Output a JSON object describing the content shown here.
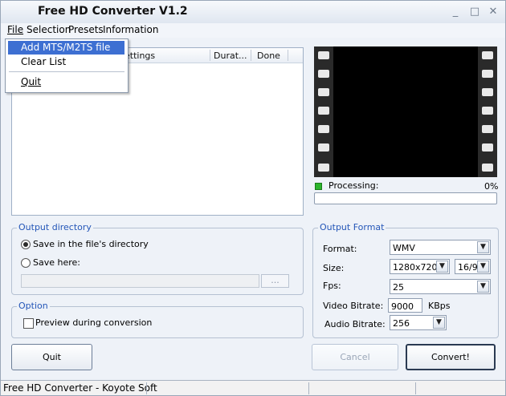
{
  "window": {
    "title": "Free HD Converter V1.2"
  },
  "titlebar_buttons": {
    "minimize": "_",
    "maximize": "□",
    "close": "✕"
  },
  "menu": [
    {
      "label": "File"
    },
    {
      "label": "Selection"
    },
    {
      "label": "Presets"
    },
    {
      "label": "Information"
    }
  ],
  "file_menu": {
    "items": [
      {
        "label": "Add MTS/M2TS file",
        "selected": true
      },
      {
        "label": "Clear List"
      },
      {
        "label": "Quit"
      }
    ]
  },
  "file_list": {
    "columns": [
      {
        "label": "ettings"
      },
      {
        "label": "Durat..."
      },
      {
        "label": "Done"
      }
    ],
    "rows": []
  },
  "preview": {
    "processing_label": "Processing:",
    "progress_text": "0%",
    "progress_value": 0
  },
  "output_directory": {
    "title": "Output directory",
    "option_same": "Save in the file's directory",
    "option_here": "Save here:",
    "selected": "same",
    "path_value": "",
    "browse_label": "..."
  },
  "option_group": {
    "title": "Option",
    "preview_label": "Preview during conversion",
    "preview_checked": false
  },
  "output_format": {
    "title": "Output Format",
    "format_label": "Format:",
    "format_value": "WMV",
    "size_label": "Size:",
    "size_value": "1280x720",
    "aspect_value": "16/9",
    "fps_label": "Fps:",
    "fps_value": "25",
    "video_bitrate_label": "Video Bitrate:",
    "video_bitrate_value": "9000",
    "video_bitrate_unit": "KBps",
    "audio_bitrate_label": "Audio Bitrate:",
    "audio_bitrate_value": "256"
  },
  "buttons": {
    "quit": "Quit",
    "cancel": "Cancel",
    "convert": "Convert!"
  },
  "status": {
    "text": "Free HD Converter - Koyote Soft"
  },
  "icons": {
    "radio": "radio-icon",
    "dropdown_arrow": "chevron-down-icon",
    "status_led": "led-icon"
  },
  "colors": {
    "accent": "#2456b8",
    "menu_highlight": "#3d6fd2",
    "led": "#2cb52c"
  }
}
